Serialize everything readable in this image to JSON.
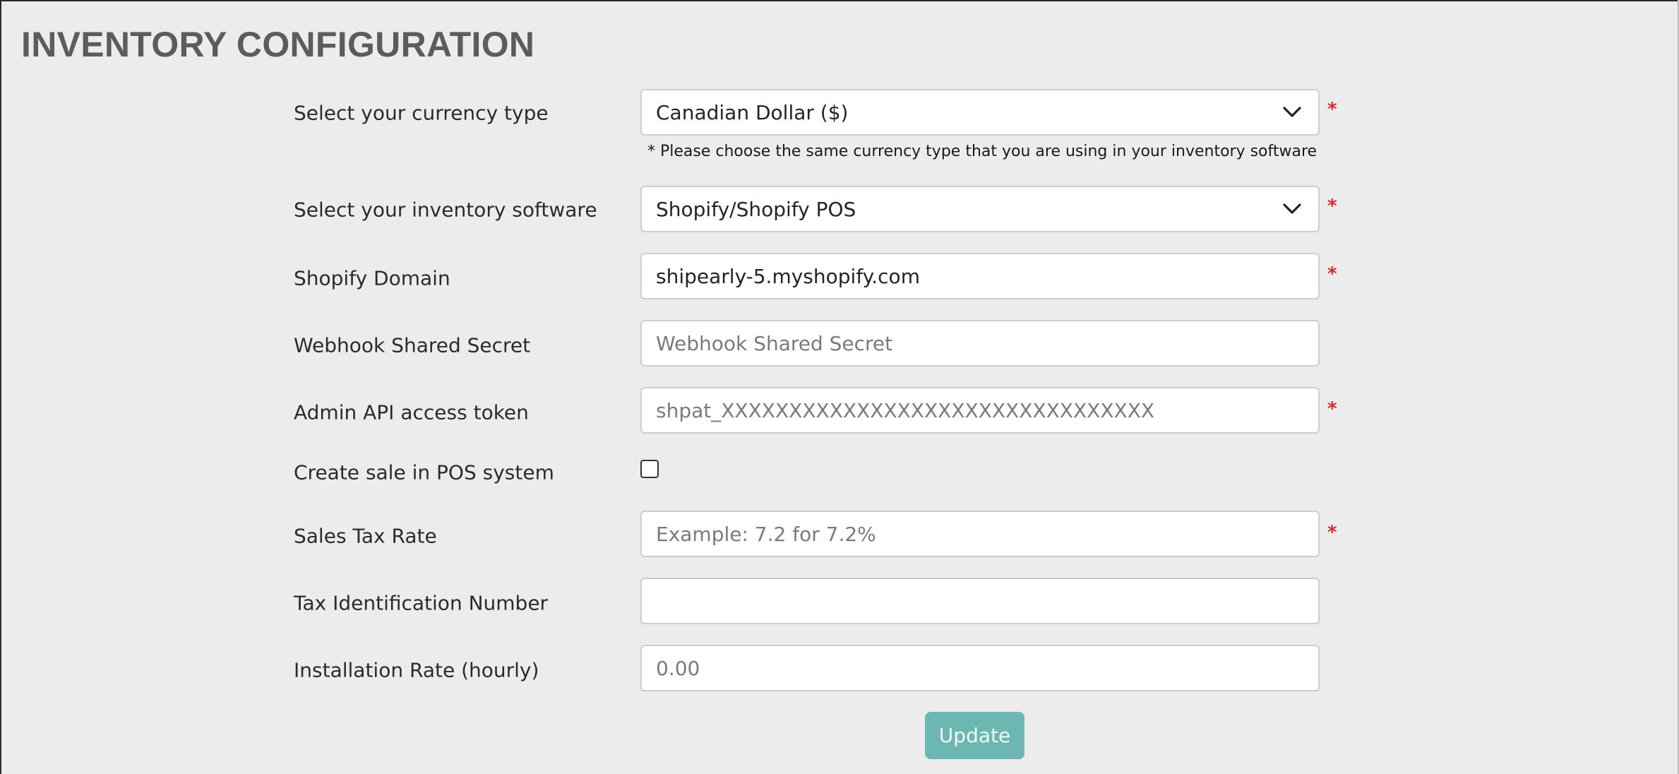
{
  "page": {
    "title": "INVENTORY CONFIGURATION"
  },
  "form": {
    "currency": {
      "label": "Select your currency type",
      "value": "Canadian Dollar ($)",
      "required": "*",
      "hint": "* Please choose the same currency type that you are using in your inventory software"
    },
    "software": {
      "label": "Select your inventory software",
      "value": "Shopify/Shopify POS",
      "required": "*"
    },
    "shopify_domain": {
      "label": "Shopify Domain",
      "value": "shipearly-5.myshopify.com",
      "required": "*"
    },
    "webhook_secret": {
      "label": "Webhook Shared Secret",
      "placeholder": "Webhook Shared Secret"
    },
    "admin_token": {
      "label": "Admin API access token",
      "placeholder": "shpat_XXXXXXXXXXXXXXXXXXXXXXXXXXXXXXXX",
      "required": "*"
    },
    "create_sale": {
      "label": "Create sale in POS system",
      "checked": false
    },
    "sales_tax": {
      "label": "Sales Tax Rate",
      "placeholder": "Example: 7.2 for 7.2%",
      "required": "*"
    },
    "tax_id": {
      "label": "Tax Identification Number",
      "value": ""
    },
    "install_rate": {
      "label": "Installation Rate (hourly)",
      "placeholder": "0.00"
    },
    "submit_label": "Update"
  },
  "icons": {
    "select_arrow": "chevron-down-icon"
  },
  "colors": {
    "background": "#ececec",
    "title": "#5c5c5c",
    "required": "#e0282a",
    "button": "#6cb7b1"
  }
}
